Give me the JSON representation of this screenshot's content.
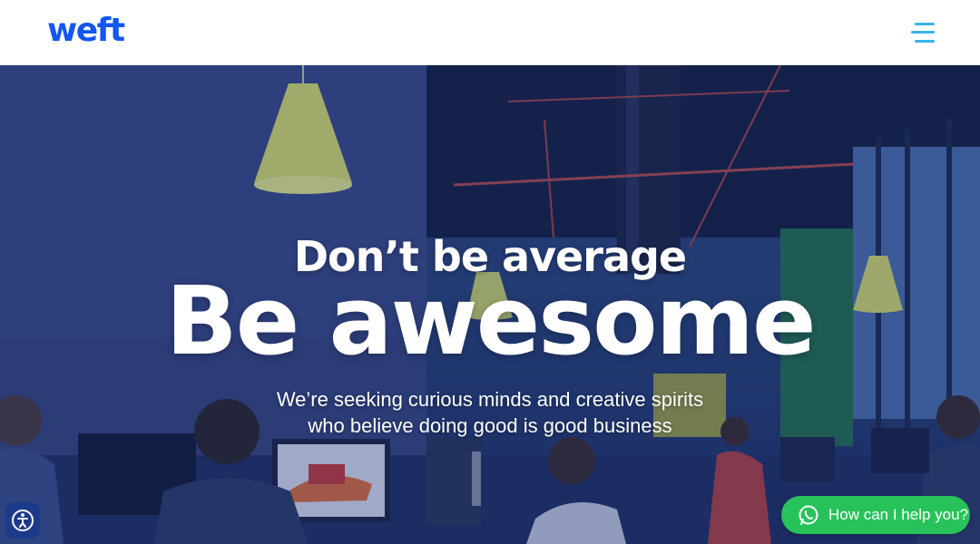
{
  "brand": {
    "logo_text": "weft",
    "color": "#1456f0"
  },
  "header": {
    "menu_icon": "hamburger-menu-icon",
    "menu_color": "#3bb3e6"
  },
  "hero": {
    "kicker": "Don’t be average",
    "headline": "Be awesome",
    "subtitle": "We’re seeking curious minds and creative spirits who believe doing good is good business",
    "background_image": "office workspace with people at computers"
  },
  "widgets": {
    "accessibility_icon": "accessibility-icon",
    "chat_label": "How can I help you?",
    "chat_icon": "whatsapp-icon",
    "chat_color": "#27c35a"
  }
}
